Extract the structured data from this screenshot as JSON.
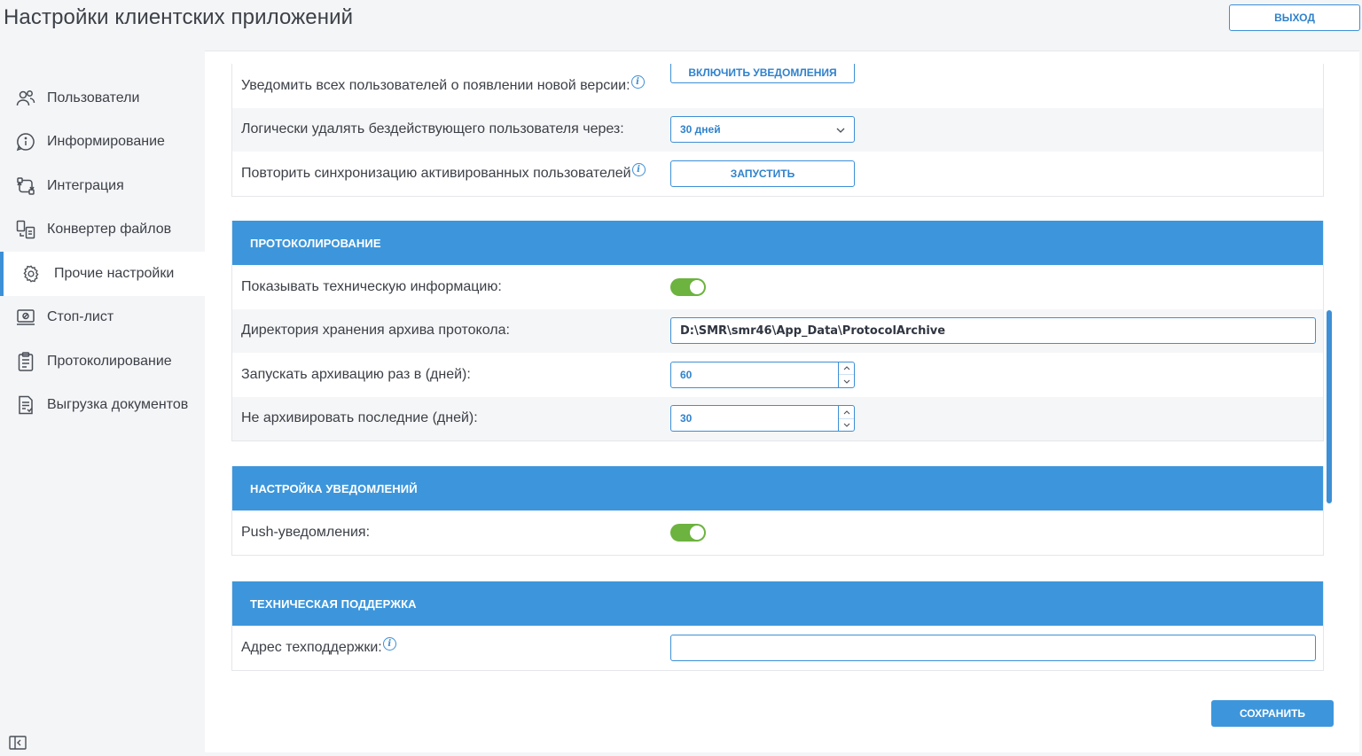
{
  "app": {
    "title": "Настройки клиентских приложений",
    "logout_label": "ВЫХОД"
  },
  "sidebar": {
    "items": [
      {
        "label": "Пользователи",
        "icon": "users-icon"
      },
      {
        "label": "Информирование",
        "icon": "info-bubble-icon"
      },
      {
        "label": "Интеграция",
        "icon": "integration-icon"
      },
      {
        "label": "Конвертер файлов",
        "icon": "file-convert-icon"
      },
      {
        "label": "Прочие настройки",
        "icon": "gear-icon",
        "active": true
      },
      {
        "label": "Стоп-лист",
        "icon": "stop-list-icon"
      },
      {
        "label": "Протоколирование",
        "icon": "clipboard-icon"
      },
      {
        "label": "Выгрузка документов",
        "icon": "document-export-icon"
      }
    ]
  },
  "general": {
    "notify_label": "Уведомить всех пользователей о появлении новой версии:",
    "notify_button": "ВКЛЮЧИТЬ УВЕДОМЛЕНИЯ",
    "delete_label": "Логически удалять бездействующего пользователя через:",
    "delete_value": "30 дней",
    "sync_label": "Повторить синхронизацию активированных пользователей",
    "sync_button": "ЗАПУСТИТЬ"
  },
  "logging": {
    "title": "ПРОТОКОЛИРОВАНИЕ",
    "show_tech_label": "Показывать техническую информацию:",
    "show_tech_on": true,
    "archive_dir_label": "Директория хранения архива протокола:",
    "archive_dir_value": "D:\\SMR\\smr46\\App_Data\\ProtocolArchive",
    "archive_period_label": "Запускать архивацию раз в (дней):",
    "archive_period_value": "60",
    "keep_label": "Не архивировать последние (дней):",
    "keep_value": "30"
  },
  "notifications": {
    "title": "НАСТРОЙКА УВЕДОМЛЕНИЙ",
    "push_label": "Push-уведомления:",
    "push_on": true
  },
  "support": {
    "title": "ТЕХНИЧЕСКАЯ ПОДДЕРЖКА",
    "address_label": "Адрес техподдержки:",
    "address_value": ""
  },
  "footer": {
    "save_label": "СОХРАНИТЬ"
  },
  "colors": {
    "accent": "#3d96db",
    "toggle_on": "#6cb33f"
  }
}
